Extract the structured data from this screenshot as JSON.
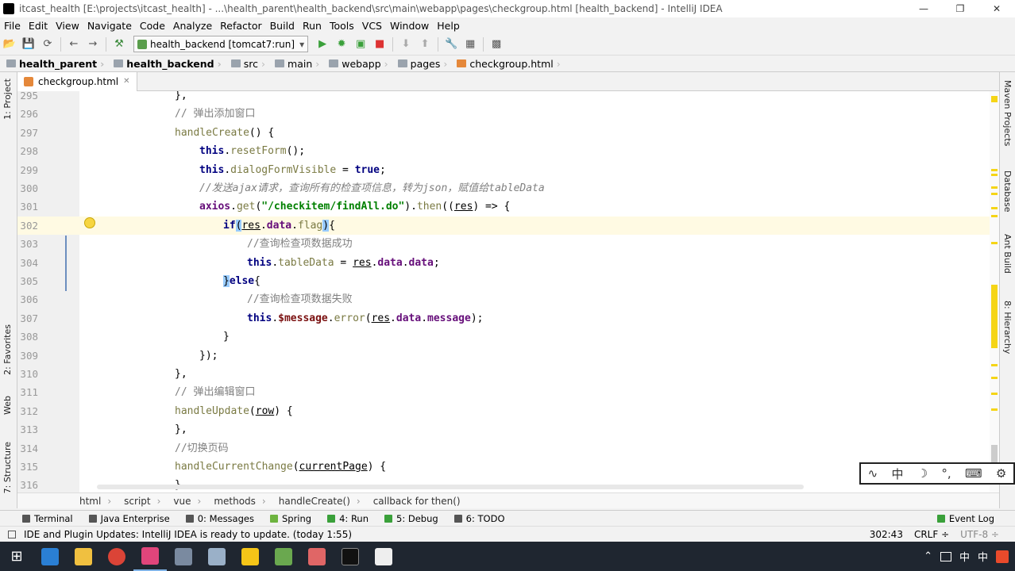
{
  "window": {
    "title": "itcast_health [E:\\projects\\itcast_health] - ...\\health_parent\\health_backend\\src\\main\\webapp\\pages\\checkgroup.html [health_backend] - IntelliJ IDEA",
    "minimize": "—",
    "restore": "❐",
    "close": "✕"
  },
  "menu": [
    "File",
    "Edit",
    "View",
    "Navigate",
    "Code",
    "Analyze",
    "Refactor",
    "Build",
    "Run",
    "Tools",
    "VCS",
    "Window",
    "Help"
  ],
  "toolbar": {
    "run_config": "health_backend [tomcat7:run]",
    "run_config_arrow": "▾"
  },
  "breadcrumbs": [
    "health_parent",
    "health_backend",
    "src",
    "main",
    "webapp",
    "pages",
    "checkgroup.html"
  ],
  "left_tabs": {
    "project": "1: Project",
    "favorites": "2: Favorites",
    "web": "Web",
    "structure": "7: Structure"
  },
  "right_tabs": {
    "maven": "Maven Projects",
    "database": "Database",
    "ant": "Ant Build",
    "hierarchy": "8: Hierarchy"
  },
  "editor_tab": {
    "label": "checkgroup.html",
    "close": "✕"
  },
  "code_lines": [
    {
      "n": "295"
    },
    {
      "n": "296"
    },
    {
      "n": "297"
    },
    {
      "n": "298"
    },
    {
      "n": "299"
    },
    {
      "n": "300"
    },
    {
      "n": "301"
    },
    {
      "n": "302"
    },
    {
      "n": "303"
    },
    {
      "n": "304"
    },
    {
      "n": "305"
    },
    {
      "n": "306"
    },
    {
      "n": "307"
    },
    {
      "n": "308"
    },
    {
      "n": "309"
    },
    {
      "n": "310"
    },
    {
      "n": "311"
    },
    {
      "n": "312"
    },
    {
      "n": "313"
    },
    {
      "n": "314"
    },
    {
      "n": "315"
    },
    {
      "n": "316"
    }
  ],
  "code_text": {
    "l295": "},",
    "l296": "// 弹出添加窗口",
    "l297a": "handleCreate",
    "l297b": "() {",
    "l298a": "this",
    "l298b": ".",
    "l298c": "resetForm",
    "l298d": "();",
    "l299a": "this",
    "l299b": ".",
    "l299c": "dialogFormVisible",
    "l299d": " = ",
    "l299e": "true",
    "l299f": ";",
    "l300": "//发送ajax请求，查询所有的检查项信息，转为json，赋值给tableData",
    "l301a": "axios",
    "l301b": ".",
    "l301c": "get",
    "l301d": "(",
    "l301e": "\"/checkitem/findAll.do\"",
    "l301f": ").",
    "l301g": "then",
    "l301h": "((",
    "l301i": "res",
    "l301j": ") => {",
    "l302a": "if",
    "l302b": "(",
    "l302c": "res",
    "l302d": ".",
    "l302e": "data",
    "l302f": ".",
    "l302g": "flag",
    "l302h": ")",
    "l302i": "{",
    "l303": "//查询检查项数据成功",
    "l304a": "this",
    "l304b": ".",
    "l304c": "tableData",
    "l304d": " = ",
    "l304e": "res",
    "l304f": ".",
    "l304g": "data",
    "l304h": ".",
    "l304i": "data",
    "l304j": ";",
    "l305a": "}",
    "l305b": "else",
    "l305c": "{",
    "l306": "//查询检查项数据失败",
    "l307a": "this",
    "l307b": ".",
    "l307c": "$message",
    "l307d": ".",
    "l307e": "error",
    "l307f": "(",
    "l307g": "res",
    "l307h": ".",
    "l307i": "data",
    "l307j": ".",
    "l307k": "message",
    "l307l": ");",
    "l308": "}",
    "l309": "});",
    "l310": "},",
    "l311": "// 弹出编辑窗口",
    "l312a": "handleUpdate",
    "l312b": "(",
    "l312c": "row",
    "l312d": ") {",
    "l313": "},",
    "l314": "//切换页码",
    "l315a": "handleCurrentChange",
    "l315b": "(",
    "l315c": "currentPage",
    "l315d": ") {",
    "l316": "},"
  },
  "path_bar": [
    "html",
    "script",
    "vue",
    "methods",
    "handleCreate()",
    "callback for then()"
  ],
  "tool_tabs": {
    "terminal": "Terminal",
    "java_enterprise": "Java Enterprise",
    "messages": "0: Messages",
    "spring": "Spring",
    "run": "4: Run",
    "debug": "5: Debug",
    "todo": "6: TODO",
    "event_log": "Event Log"
  },
  "status": {
    "message": "IDE and Plugin Updates: IntelliJ IDEA is ready to update. (today 1:55)",
    "position": "302:43",
    "line_sep": "CRLF ÷",
    "encoding": "UTF-8 ÷"
  },
  "ime": {
    "mode": "中",
    "moon": "☽",
    "punct": "°,",
    "kbd": "⌨",
    "gear": "⚙",
    "logo": "∿"
  },
  "tray": {
    "up": "⌃",
    "ime": "中",
    "lang": "中"
  },
  "colors": {
    "keyword": "#000080",
    "string": "#008000",
    "comment": "#808080",
    "field": "#660e7a",
    "method": "#7a7a43",
    "caret_line": "#fffae3",
    "brace_highlight": "#99ccff"
  }
}
